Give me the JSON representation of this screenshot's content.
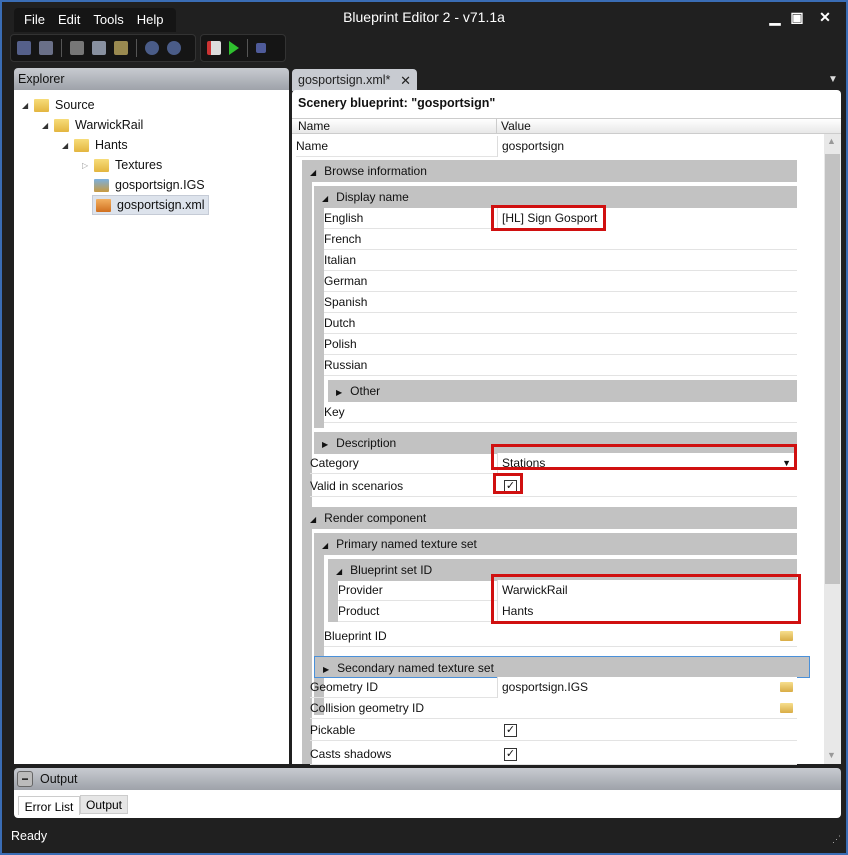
{
  "window": {
    "title": "Blueprint Editor 2 - v71.1a"
  },
  "menu": [
    "File",
    "Edit",
    "Tools",
    "Help"
  ],
  "explorer": {
    "title": "Explorer",
    "tree": [
      "Source",
      "WarwickRail",
      "Hants",
      "Textures",
      "gosportsign.IGS",
      "gosportsign.xml"
    ]
  },
  "tab": {
    "label": "gosportsign.xml*",
    "close": "✕"
  },
  "editor": {
    "heading": "Scenery blueprint: \"gosportsign\"",
    "col_name": "Name",
    "col_value": "Value"
  },
  "rows": {
    "name": {
      "label": "Name",
      "value": "gosportsign"
    },
    "browse": "Browse information",
    "display": "Display name",
    "english": {
      "label": "English",
      "value": "[HL] Sign Gosport"
    },
    "french": {
      "label": "French",
      "value": ""
    },
    "italian": {
      "label": "Italian",
      "value": ""
    },
    "german": {
      "label": "German",
      "value": ""
    },
    "spanish": {
      "label": "Spanish",
      "value": ""
    },
    "dutch": {
      "label": "Dutch",
      "value": ""
    },
    "polish": {
      "label": "Polish",
      "value": ""
    },
    "russian": {
      "label": "Russian",
      "value": ""
    },
    "other": "Other",
    "key": {
      "label": "Key",
      "value": ""
    },
    "description": "Description",
    "category": {
      "label": "Category",
      "value": "Stations"
    },
    "valid": {
      "label": "Valid in scenarios",
      "value": "✓"
    },
    "render": "Render component",
    "primary": "Primary named texture set",
    "bsid": "Blueprint set ID",
    "provider": {
      "label": "Provider",
      "value": "WarwickRail"
    },
    "product": {
      "label": "Product",
      "value": "Hants"
    },
    "bpid": {
      "label": "Blueprint ID",
      "value": ""
    },
    "secondary": "Secondary named texture set",
    "geometry": {
      "label": "Geometry ID",
      "value": "gosportsign.IGS"
    },
    "collision": {
      "label": "Collision geometry ID",
      "value": ""
    },
    "pickable": {
      "label": "Pickable",
      "value": "✓"
    },
    "shadows": {
      "label": "Casts shadows",
      "value": "✓"
    }
  },
  "output": {
    "title": "Output",
    "collapse": "−",
    "tabs": [
      "Error List",
      "Output"
    ]
  },
  "status": {
    "text": "Ready"
  },
  "colors": {
    "highlight": "#d01010",
    "window_border": "#3a6db5"
  }
}
